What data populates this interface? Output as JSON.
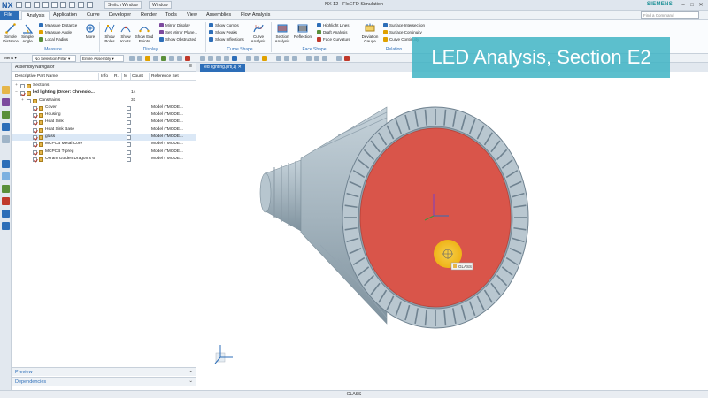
{
  "titlebar": {
    "app_logo": "NX",
    "switch_window": "Switch Window",
    "window_menu": "Window",
    "title": "NX 12 - FloEFD Simulation",
    "brand": "SIEMENS"
  },
  "menubar": {
    "tabs": [
      "File",
      "Analysis",
      "Application",
      "Curve",
      "Developer",
      "Render",
      "Tools",
      "View",
      "Assemblies",
      "Flow Analysis"
    ],
    "active": "Analysis",
    "search_placeholder": "Find a Command"
  },
  "ribbon": {
    "measure": {
      "group_label": "Measure",
      "simple_distance": "Simple Distance",
      "simple_angle": "Simple Angle",
      "measure_distance": "Measure Distance",
      "measure_angle": "Measure Angle",
      "local_radius": "Local Radius",
      "more": "More"
    },
    "display": {
      "group_label": "Display",
      "show_poles": "Show Poles",
      "show_knots": "Show Knots",
      "show_end_points": "Show End Points",
      "mirror_display": "Mirror Display",
      "set_mirror_plane": "Set Mirror Plane...",
      "show_obstructed": "Show Obstructed"
    },
    "curve_shape": {
      "group_label": "Curve Shape",
      "show_combs": "Show Combs",
      "show_peaks": "Show Peaks",
      "show_inflections": "Show Inflections",
      "curve_analysis": "Curve Analysis"
    },
    "face_shape": {
      "group_label": "Face Shape",
      "section_analysis": "Section Analysis",
      "reflection": "Reflection",
      "highlight_lines": "Highlight Lines",
      "draft_analysis": "Draft Analysis",
      "face_curvature": "Face Curvature"
    },
    "relation": {
      "group_label": "Relation",
      "deviation_gauge": "Deviation Gauge",
      "surface_intersection": "Surface Intersection",
      "surface_continuity": "Surface Continuity",
      "curve_continuity": "Curve Continuity"
    }
  },
  "toolbar2": {
    "menu": "Menu",
    "selection_filter": "No Selection Filter",
    "scope": "Entire Assembly"
  },
  "navigator": {
    "title": "Assembly Navigator",
    "columns": [
      "Descriptive Part Name",
      "Info",
      "R..",
      "M",
      "Count",
      "Reference Set"
    ],
    "rows": [
      {
        "expander": "+",
        "name": "Sections",
        "count": "",
        "ref": "",
        "indent": 0,
        "checked": false
      },
      {
        "expander": "−",
        "name": "led lighting (Order: Chronolo...",
        "count": "14",
        "ref": "",
        "indent": 0,
        "checked": true,
        "bold": true
      },
      {
        "expander": "+",
        "name": "Constraints",
        "count": "31",
        "ref": "",
        "indent": 1,
        "checked": false
      },
      {
        "expander": "",
        "name": "Cover",
        "count": "",
        "ref": "Model (\"MODE...",
        "indent": 2,
        "checked": true
      },
      {
        "expander": "",
        "name": "Housing",
        "count": "",
        "ref": "Model (\"MODE...",
        "indent": 2,
        "checked": true
      },
      {
        "expander": "",
        "name": "Heat Sink",
        "count": "",
        "ref": "Model (\"MODE...",
        "indent": 2,
        "checked": true
      },
      {
        "expander": "",
        "name": "Heat Sink Base",
        "count": "",
        "ref": "Model (\"MODE...",
        "indent": 2,
        "checked": true
      },
      {
        "expander": "",
        "name": "glass",
        "count": "",
        "ref": "Model (\"MODE...",
        "indent": 2,
        "checked": true,
        "selected": true
      },
      {
        "expander": "",
        "name": "MCPCB Metal Core",
        "count": "",
        "ref": "Model (\"MODE...",
        "indent": 2,
        "checked": true
      },
      {
        "expander": "",
        "name": "MCPCB T-preg",
        "count": "",
        "ref": "Model (\"MODE...",
        "indent": 2,
        "checked": true
      },
      {
        "expander": "",
        "name": "Osram Golden Dragon x 6",
        "count": "",
        "ref": "Model (\"MODE...",
        "indent": 2,
        "checked": true
      }
    ],
    "preview_label": "Preview",
    "dependencies_label": "Dependencies"
  },
  "viewport": {
    "tab_label": "led lighting.prt(1)",
    "selection_tag": "GLASS"
  },
  "status": {
    "text": "GLASS"
  },
  "overlay": {
    "title": "LED Analysis, Section E2"
  },
  "colors": {
    "accent": "#2d6eb8",
    "brand": "#1a8f95",
    "overlay": "#40b4c4",
    "section_face": "#d9554a",
    "housing": "#a9b8c2",
    "highlight": "#f2c21b"
  }
}
